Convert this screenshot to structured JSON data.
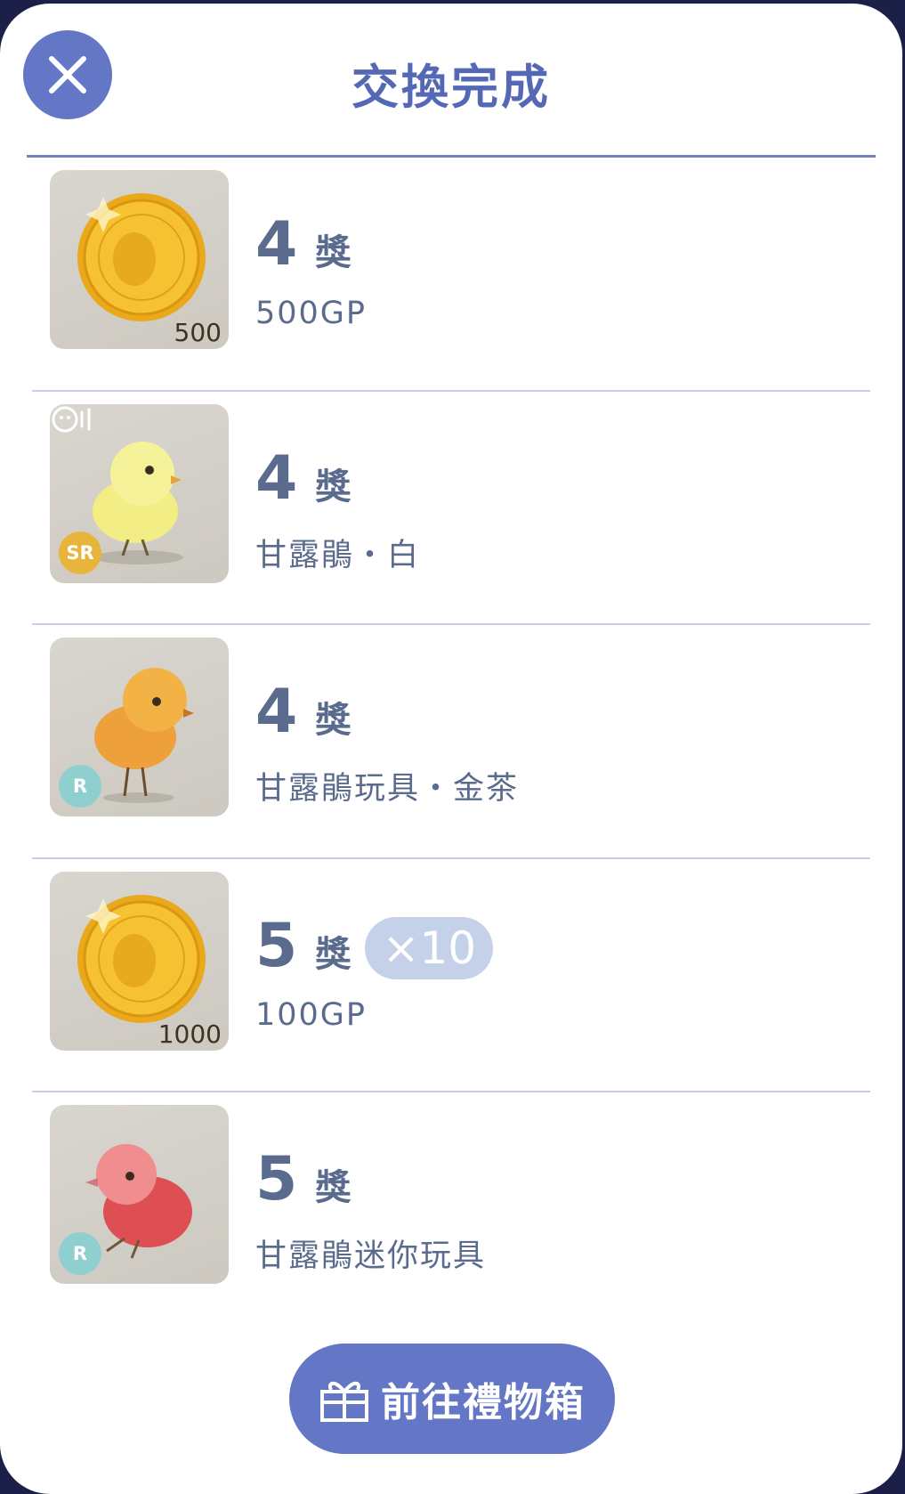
{
  "header": {
    "title": "交換完成"
  },
  "prize_suffix": "獎",
  "items": [
    {
      "prize": "4",
      "name": "500GP",
      "thumb": "gold-coin",
      "coin_label": "500",
      "rarity": "",
      "qty": ""
    },
    {
      "prize": "4",
      "name": "甘露鵑・白",
      "thumb": "yellow-chick",
      "coin_label": "",
      "rarity": "SR",
      "qty": ""
    },
    {
      "prize": "4",
      "name": "甘露鵑玩具・金茶",
      "thumb": "orange-chick",
      "coin_label": "",
      "rarity": "R",
      "qty": ""
    },
    {
      "prize": "5",
      "name": "100GP",
      "thumb": "gold-coin",
      "coin_label": "1000",
      "rarity": "",
      "qty": "×10"
    },
    {
      "prize": "5",
      "name": "甘露鵑迷你玩具",
      "thumb": "red-chick",
      "coin_label": "",
      "rarity": "R",
      "qty": ""
    }
  ],
  "footer": {
    "button_label": "前往禮物箱"
  },
  "colors": {
    "accent": "#6476c6",
    "title": "#5468b5",
    "text": "#5a6b8d",
    "badge": "#c5d1e8"
  }
}
